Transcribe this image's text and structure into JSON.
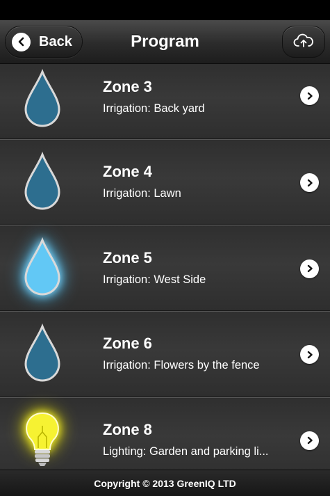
{
  "header": {
    "back_label": "Back",
    "title": "Program",
    "cloud_icon": "cloud-upload-icon"
  },
  "zones": [
    {
      "name": "Zone 3",
      "description": "Irrigation: Back yard",
      "icon": "water-drop-icon",
      "active": false
    },
    {
      "name": "Zone 4",
      "description": "Irrigation: Lawn",
      "icon": "water-drop-icon",
      "active": false
    },
    {
      "name": "Zone 5",
      "description": "Irrigation: West Side",
      "icon": "water-drop-icon",
      "active": true
    },
    {
      "name": "Zone 6",
      "description": "Irrigation: Flowers by the fence",
      "icon": "water-drop-icon",
      "active": false
    },
    {
      "name": "Zone 8",
      "description": "Lighting: Garden and parking li...",
      "icon": "light-bulb-icon",
      "active": true
    }
  ],
  "footer": {
    "copyright": "Copyright © 2013 GreenIQ LTD"
  },
  "colors": {
    "drop_inactive": "#2d6e8f",
    "drop_active": "#62c8f5",
    "bulb_active": "#f6f232"
  }
}
